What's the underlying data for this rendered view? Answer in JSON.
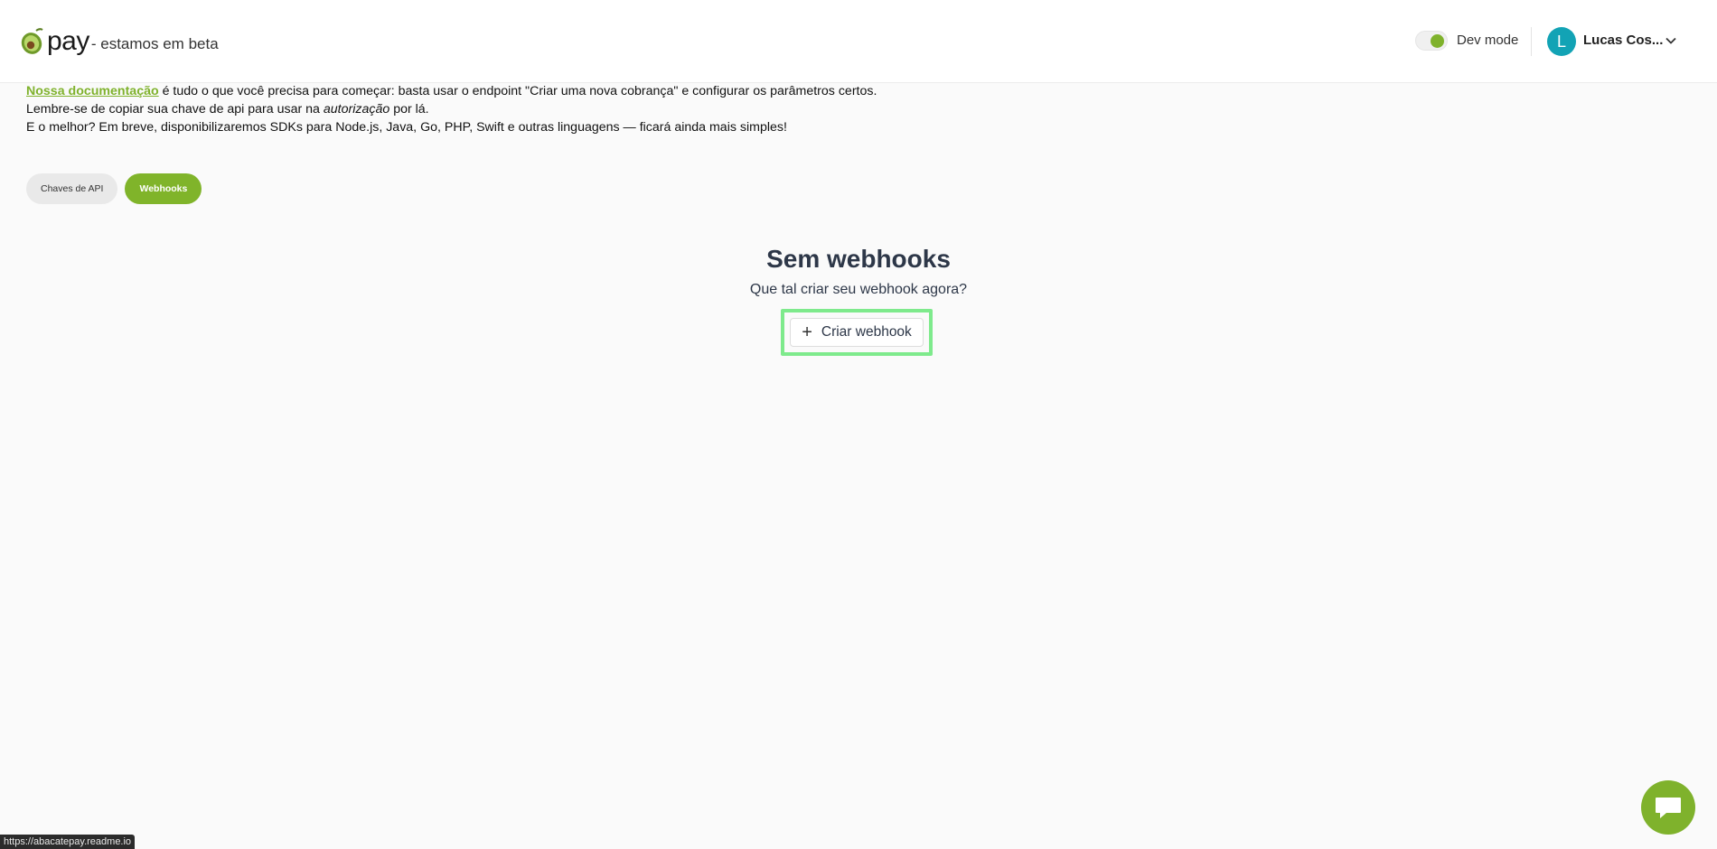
{
  "header": {
    "logo_word": "pay",
    "logo_tagline": "- estamos em beta",
    "dev_mode_label": "Dev mode",
    "user_initial": "L",
    "user_name": "Lucas Cos..."
  },
  "intro": {
    "doc_link": "Nossa documentação",
    "line1_rest": " é tudo o que você precisa para começar: basta usar o endpoint \"Criar uma nova cobrança\" e configurar os parâmetros certos.",
    "line2_before": "Lembre-se de copiar sua chave de api para usar na ",
    "line2_em": "autorização",
    "line2_after": " por lá.",
    "line3": "E o melhor? Em breve, disponibilizaremos SDKs para Node.js, Java, Go, PHP, Swift e outras linguagens — ficará ainda mais simples!"
  },
  "tabs": [
    {
      "label": "Chaves de API",
      "active": false
    },
    {
      "label": "Webhooks",
      "active": true
    }
  ],
  "empty_state": {
    "title": "Sem webhooks",
    "subtitle": "Que tal criar seu webhook agora?",
    "button_label": "Criar webhook"
  },
  "status_bar": {
    "url": "https://abacatepay.readme.io"
  },
  "colors": {
    "brand_green": "#7fb22c",
    "avatar_teal": "#12a3b5",
    "highlight": "#7eea8c"
  },
  "icons": [
    "avocado-logo-icon",
    "chevron-down-icon",
    "plus-icon",
    "chat-icon"
  ]
}
